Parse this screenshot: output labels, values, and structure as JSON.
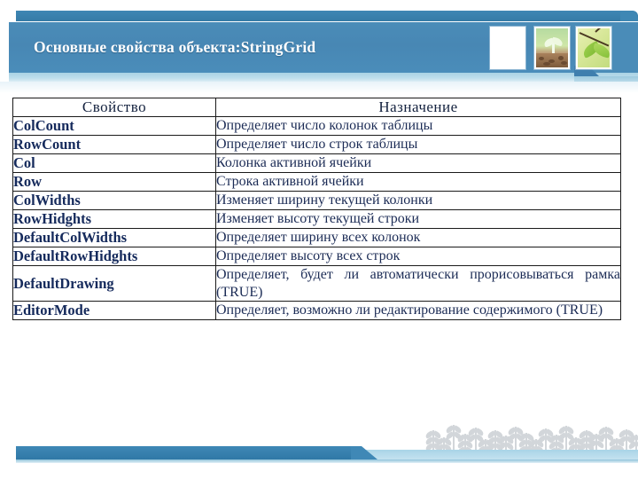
{
  "slide": {
    "title": "Основные свойства объекта:StringGrid",
    "accent_color": "#4a8cb8",
    "title_color": "#ffffff",
    "table_text_color": "#152a5c"
  },
  "header": {
    "thumbnails": [
      {
        "name": "blank-thumbnail",
        "kind": "blank"
      },
      {
        "name": "sprout-photo-thumbnail",
        "kind": "sprout"
      },
      {
        "name": "leaves-photo-thumbnail",
        "kind": "leaves"
      }
    ]
  },
  "table": {
    "columns": [
      "Свойство",
      "Назначение"
    ],
    "rows": [
      {
        "property": "ColCount",
        "purpose": "Определяет число колонок таблицы",
        "justify": false
      },
      {
        "property": "RowCount",
        "purpose": "Определяет число строк таблицы",
        "justify": false
      },
      {
        "property": "Col",
        "purpose": "Колонка активной ячейки",
        "justify": false
      },
      {
        "property": "Row",
        "purpose": "Строка активной ячейки",
        "justify": false
      },
      {
        "property": "ColWidths",
        "purpose": "Изменяет ширину текущей колонки",
        "justify": false
      },
      {
        "property": "RowHidghts",
        "purpose": "Изменяет высоту текущей строки",
        "justify": false
      },
      {
        "property": "DefaultColWidths",
        "purpose": "Определяет ширину всех колонок",
        "justify": false
      },
      {
        "property": "DefaultRowHidghts",
        "purpose": "Определяет высоту всех строк",
        "justify": false
      },
      {
        "property": "DefaultDrawing",
        "purpose": "Определяет, будет ли автоматически прорисовываться рамка (TRUE)",
        "justify": true
      },
      {
        "property": "EditorMode",
        "purpose": "Определяет, возможно ли редактирование содержимого (TRUE)",
        "justify": true
      }
    ]
  },
  "decor": {
    "sprout_field": "seedling-silhouettes",
    "footer_bar_color": "#3f88b6"
  }
}
